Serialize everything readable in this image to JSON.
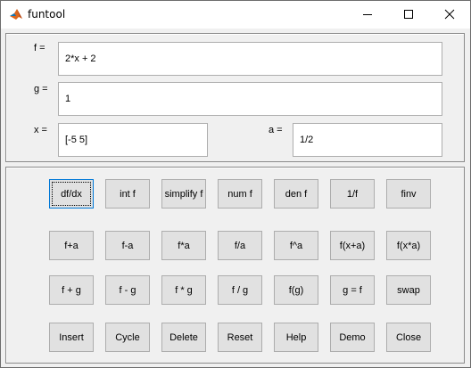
{
  "window": {
    "title": "funtool",
    "app_icon": "matlab-icon",
    "controls": [
      "minimize-icon",
      "maximize-icon",
      "close-icon"
    ]
  },
  "inputs": {
    "f": {
      "label": "f =",
      "value": "2*x + 2"
    },
    "g": {
      "label": "g =",
      "value": "1"
    },
    "x": {
      "label": "x =",
      "value": "[-5 5]"
    },
    "a": {
      "label": "a =",
      "value": "1/2"
    }
  },
  "buttons": [
    [
      "df/dx",
      "int f",
      "simplify f",
      "num f",
      "den f",
      "1/f",
      "finv"
    ],
    [
      "f+a",
      "f-a",
      "f*a",
      "f/a",
      "f^a",
      "f(x+a)",
      "f(x*a)"
    ],
    [
      "f + g",
      "f - g",
      "f * g",
      "f / g",
      "f(g)",
      "g = f",
      "swap"
    ],
    [
      "Insert",
      "Cycle",
      "Delete",
      "Reset",
      "Help",
      "Demo",
      "Close"
    ]
  ],
  "focused_button": "df/dx",
  "colors": {
    "window_bg": "#f0f0f0",
    "button_face": "#e1e1e1",
    "focus_border": "#0078d7"
  }
}
